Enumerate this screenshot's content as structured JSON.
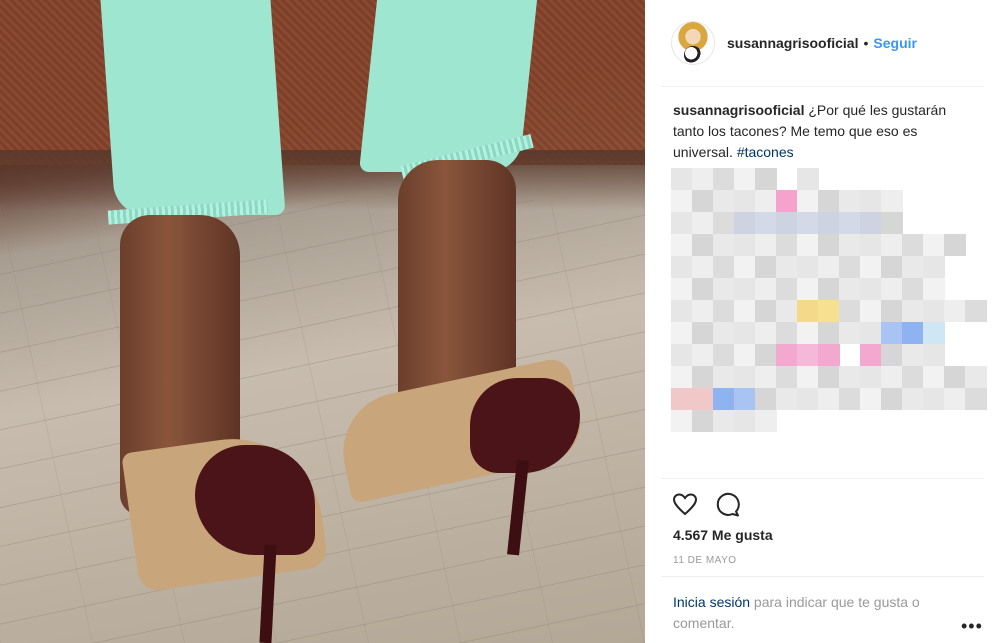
{
  "post": {
    "photo_alt": "Photo",
    "user": "susannagrisooficial",
    "follow_label": "Seguir",
    "dot": "•",
    "caption_user": "susannagrisooficial",
    "caption_text": " ¿Por qué les gustarán tanto los tacones? Me temo que eso es universal. ",
    "hashtag": "#tacones",
    "likes": "4.567 Me gusta",
    "date": "11 de mayo",
    "login_link": "Inicia sesión",
    "login_text": " para indicar que te gusta o comentar.",
    "more_label": "•••"
  },
  "colors": {
    "link": "#3897f0",
    "hashtag": "#003569",
    "text": "#262626",
    "muted": "#999999"
  },
  "icons": {
    "like": "heart-outline-icon",
    "comment": "speech-bubble-icon",
    "more": "more-horizontal-icon"
  }
}
